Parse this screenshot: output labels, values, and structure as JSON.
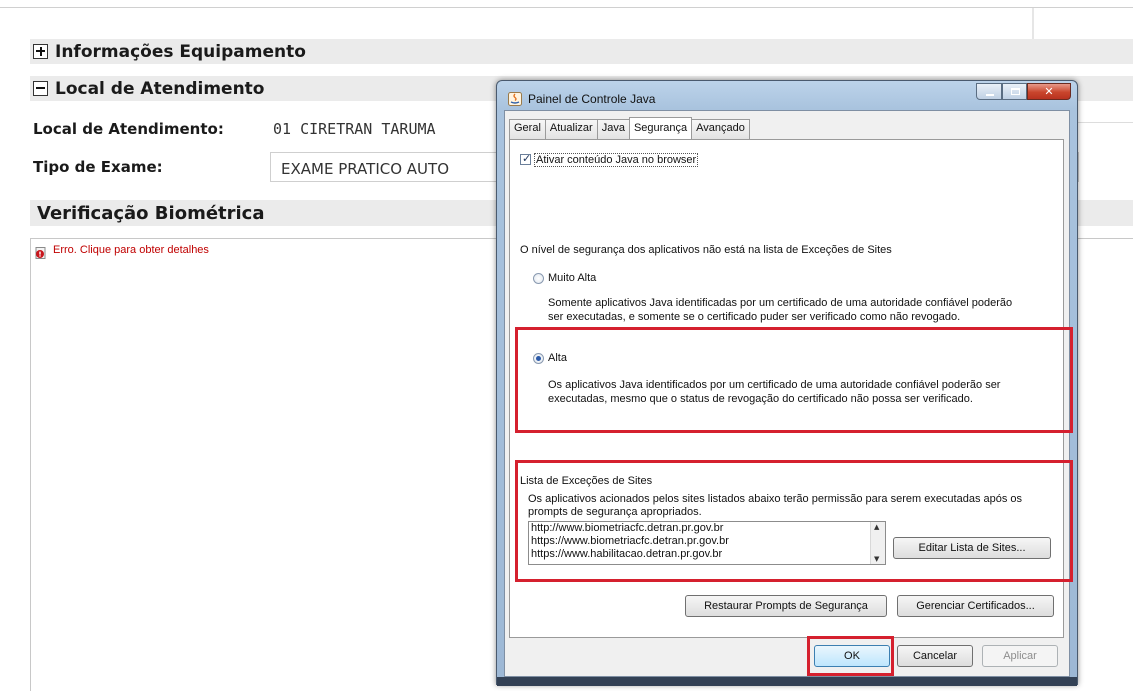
{
  "page": {
    "sections": {
      "info_equipamento": "Informações Equipamento",
      "local_atendimento": "Local de Atendimento"
    },
    "fields": {
      "local_label": "Local de Atendimento:",
      "local_value": "01 CIRETRAN TARUMA",
      "tipo_label": "Tipo de Exame:",
      "tipo_value": "EXAME PRATICO AUTO"
    },
    "biometrica": {
      "title": "Verificação Biométrica",
      "error_text": "Erro. Clique para obter detalhes"
    }
  },
  "dialog": {
    "title": "Painel de Controle Java",
    "tabs": [
      {
        "label": "Geral",
        "active": false
      },
      {
        "label": "Atualizar",
        "active": false
      },
      {
        "label": "Java",
        "active": false
      },
      {
        "label": "Segurança",
        "active": true
      },
      {
        "label": "Avançado",
        "active": false
      }
    ],
    "enable_checkbox": {
      "label": "Ativar conteúdo Java no browser",
      "checked": true
    },
    "security_level_note": "O nível de segurança dos aplicativos não está na lista de Exceções de Sites",
    "levels": [
      {
        "label": "Muito Alta",
        "selected": false,
        "desc_line1": "Somente aplicativos Java identificadas por um certificado de uma autoridade confiável poderão",
        "desc_line2": "ser executadas, e somente se o certificado puder ser verificado como não revogado."
      },
      {
        "label": "Alta",
        "selected": true,
        "desc_line1": "Os aplicativos Java identificados por um certificado de uma autoridade confiável poderão ser",
        "desc_line2": "executadas, mesmo que o status de revogação do certificado não possa ser verificado."
      }
    ],
    "exceptions": {
      "title": "Lista de Exceções de Sites",
      "desc_line1": "Os aplicativos acionados pelos sites listados abaixo terão permissão para serem executadas após os",
      "desc_line2": "prompts de segurança apropriados.",
      "sites": [
        "http://www.biometriacfc.detran.pr.gov.br",
        "https://www.biometriacfc.detran.pr.gov.br",
        "https://www.habilitacao.detran.pr.gov.br"
      ],
      "edit_button": "Editar Lista de Sites..."
    },
    "restore_button": "Restaurar Prompts de Segurança",
    "certs_button": "Gerenciar Certificados...",
    "ok_button": "OK",
    "cancel_button": "Cancelar",
    "apply_button": "Aplicar"
  },
  "colors": {
    "highlight_frame": "#d5202e",
    "error_text": "#c00000",
    "section_bar": "#ebebeb"
  }
}
